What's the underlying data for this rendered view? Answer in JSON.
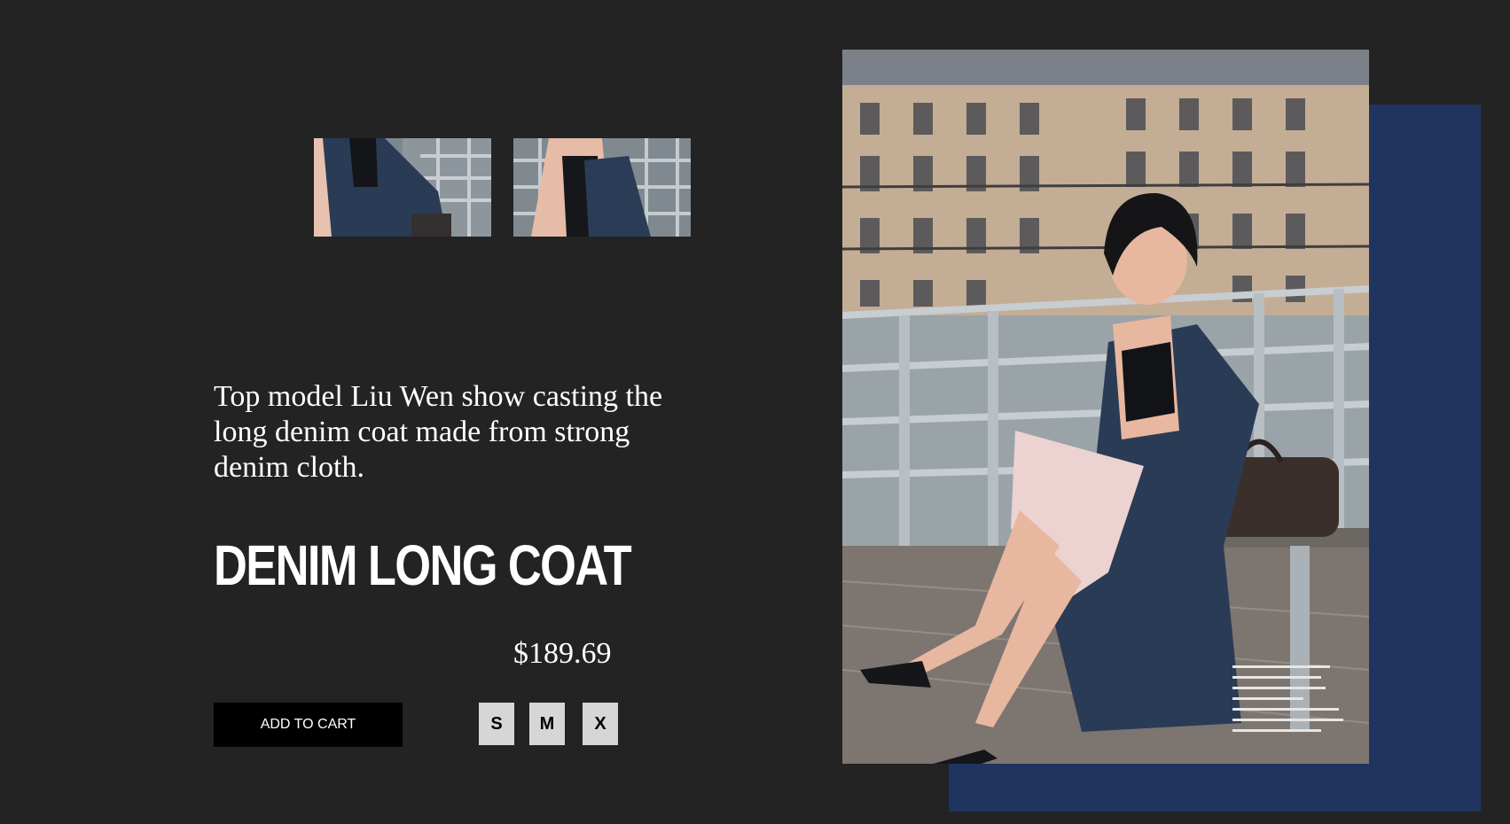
{
  "product": {
    "description": "Top model Liu Wen show casting the long denim coat made from strong denim cloth.",
    "title": "DENIM LONG COAT",
    "price": "$189.69",
    "add_to_cart_label": "ADD TO CART",
    "sizes": [
      "S",
      "M",
      "X"
    ]
  },
  "colors": {
    "background": "#232323",
    "accent_panel": "#1f345e",
    "button": "#000000",
    "size_button": "#d6d6d6"
  }
}
